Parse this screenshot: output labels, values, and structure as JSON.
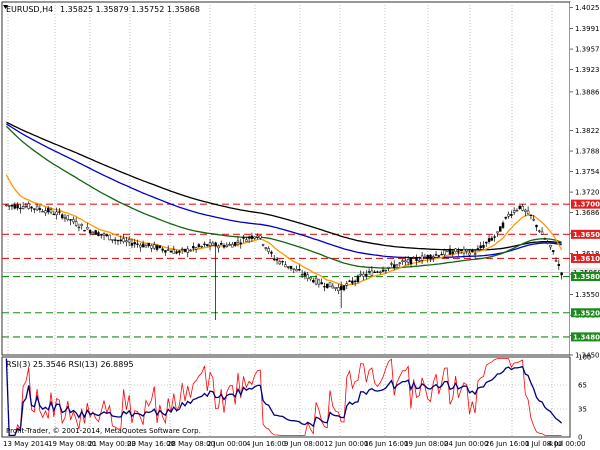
{
  "chart_data": [
    {
      "type": "candlestick",
      "title": "EURUSD,H4  1.35825 1.35879 1.35752 1.35868",
      "symbol": "EURUSD,H4",
      "ohlc_header": "1.35825 1.35879 1.35752 1.35868",
      "y_ticks": [
        "1.40255",
        "1.39910",
        "1.39570",
        "1.39230",
        "1.38860",
        "1.38220",
        "1.37880",
        "1.37540",
        "1.37200",
        "1.36860",
        "1.36520",
        "1.36180",
        "1.35840",
        "1.35500",
        "1.35160",
        "1.34820",
        "1.34500"
      ],
      "ylim": [
        1.345,
        1.4035
      ],
      "x_tick_labels": [
        "13 May 2014",
        "19 May 08:00",
        "21 May 00:00",
        "23 May 16:00",
        "28 May 08:00",
        "2 Jun 00:00",
        "4 Jun 16:00",
        "9 Jun 08:00",
        "12 Jun 00:00",
        "16 Jun 16:00",
        "19 Jun 08:00",
        "24 Jun 00:00",
        "26 Jun 16:00",
        "1 Jul 08:00",
        "4 Jul 00:00"
      ],
      "price_tags": [
        {
          "label": "1.37000",
          "value": 1.37,
          "color": "#e02020",
          "style": "dashed"
        },
        {
          "label": "1.36500",
          "value": 1.365,
          "color": "#e02020",
          "style": "dashed"
        },
        {
          "label": "1.36100",
          "value": 1.361,
          "color": "#e02020",
          "style": "dashed"
        },
        {
          "label": "1.35868",
          "value": 1.35868,
          "color": "#c0c0c0",
          "style": "solid"
        },
        {
          "label": "1.35800",
          "value": 1.358,
          "color": "#1a8a1a",
          "style": "dashed"
        },
        {
          "label": "1.35200",
          "value": 1.352,
          "color": "#1a8a1a",
          "style": "dashed"
        },
        {
          "label": "1.34800",
          "value": 1.348,
          "color": "#1a8a1a",
          "style": "dashed"
        }
      ],
      "series": [
        {
          "name": "MA black",
          "color": "#000000"
        },
        {
          "name": "MA blue",
          "color": "#0000cc"
        },
        {
          "name": "MA green",
          "color": "#116611"
        },
        {
          "name": "MA orange",
          "color": "#ff9900"
        }
      ],
      "copyright": "Profit-Trader, © 2001-2014, MetaQuotes Software Corp."
    },
    {
      "type": "line",
      "title": "RSI(3) 25.3546  RSI(13) 26.8895",
      "y_ticks": [
        "100",
        "65",
        "35",
        "0"
      ],
      "ylim": [
        0,
        100
      ],
      "levels": [
        65,
        35
      ],
      "series": [
        {
          "name": "RSI(3)",
          "color": "#ff0000"
        },
        {
          "name": "RSI(13)",
          "color": "#000080"
        }
      ]
    }
  ]
}
